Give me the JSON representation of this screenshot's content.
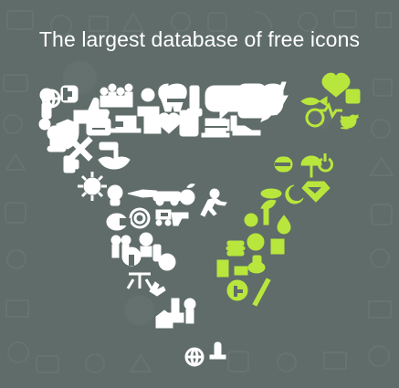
{
  "headline": "The largest database of free icons",
  "colors": {
    "background": "#5f6c69",
    "primary_icon": "#ffffff",
    "accent_icon": "#b8e63c"
  },
  "icon_groups": [
    "white-icons",
    "green-icons"
  ]
}
